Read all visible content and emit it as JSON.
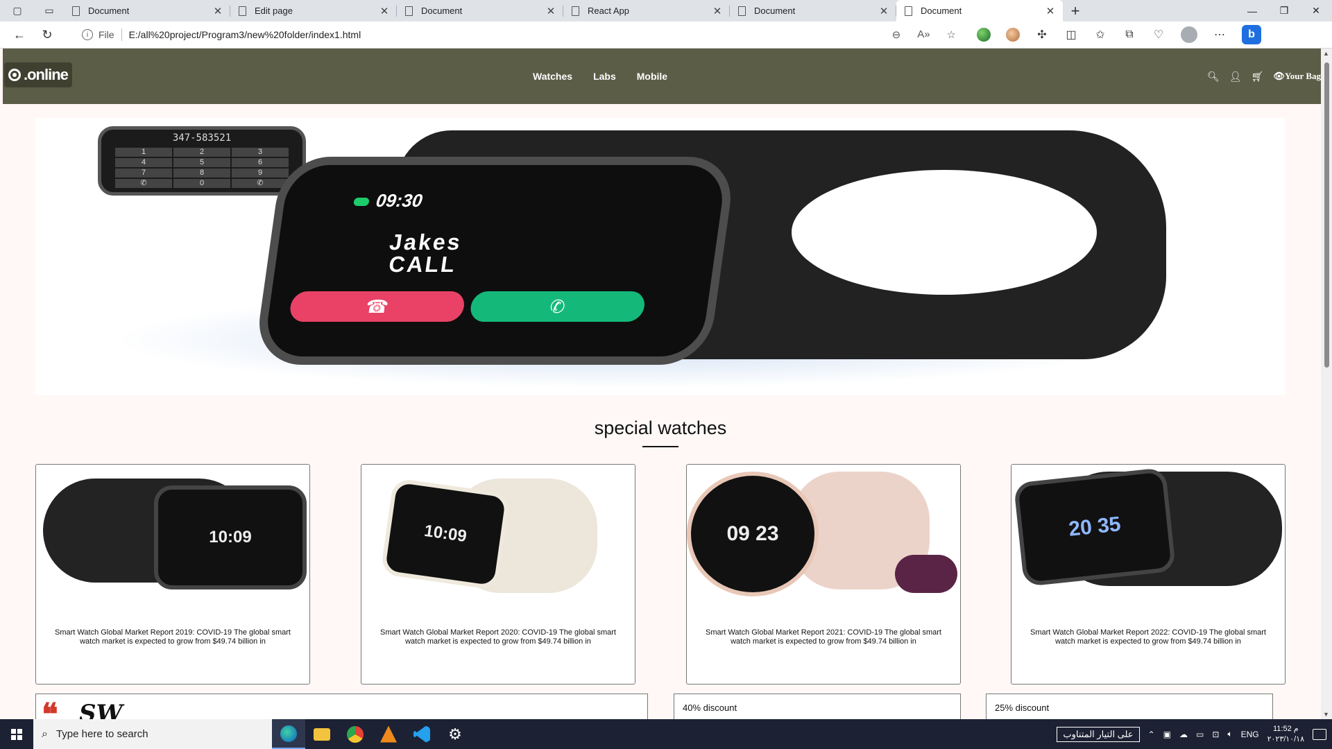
{
  "browser": {
    "tabs": [
      {
        "label": "Document",
        "active": false
      },
      {
        "label": "Edit page",
        "active": false
      },
      {
        "label": "Document",
        "active": false
      },
      {
        "label": "React App",
        "active": false
      },
      {
        "label": "Document",
        "active": false
      },
      {
        "label": "Document",
        "active": true
      }
    ],
    "address": {
      "scheme": "File",
      "url": "E:/all%20project/Program3/new%20folder/index1.html"
    }
  },
  "site": {
    "logo_text": ".online",
    "menu": [
      "Watches",
      "Labs",
      "Mobile"
    ],
    "bag_label": "Your Bag"
  },
  "hero": {
    "small_watch_number": "347-583521",
    "keypad": [
      "1",
      "2",
      "3",
      "4",
      "5",
      "6",
      "7",
      "8",
      "9",
      "✆",
      "0",
      "✆"
    ],
    "time": "09:30",
    "caller_name": "Jakes",
    "call_label": "CALL"
  },
  "section": {
    "title": "special watches"
  },
  "cards": [
    {
      "description": "Smart Watch Global Market Report 2019: COVID-19 The global smart watch market is expected to grow from $49.74 billion in",
      "face_text": "10:09"
    },
    {
      "description": "Smart Watch Global Market Report 2020: COVID-19 The global smart watch market is expected to grow from $49.74 billion in",
      "face_text": "10:09"
    },
    {
      "description": "Smart Watch Global Market Report 2021: COVID-19 The global smart watch market is expected to grow from $49.74 billion in",
      "face_text": "09 23"
    },
    {
      "description": "Smart Watch Global Market Report 2022: COVID-19 The global smart watch market is expected to grow from $49.74 billion in",
      "face_text": "20 35"
    }
  ],
  "bottom": {
    "quote_text": "SW",
    "discount_1": "40% discount",
    "discount_2": "25% discount"
  },
  "taskbar": {
    "search_placeholder": "Type here to search",
    "tray_status": "على التيار المتناوب",
    "language": "ENG",
    "time": "11:52 م",
    "date": "٢٠٢٣/١٠/١٨"
  },
  "colors": {
    "nav_background": "#5c5d47",
    "page_background": "#fff8f7",
    "call_red": "#e94266",
    "call_green": "#14b979",
    "quote_red": "#d23a2a"
  }
}
